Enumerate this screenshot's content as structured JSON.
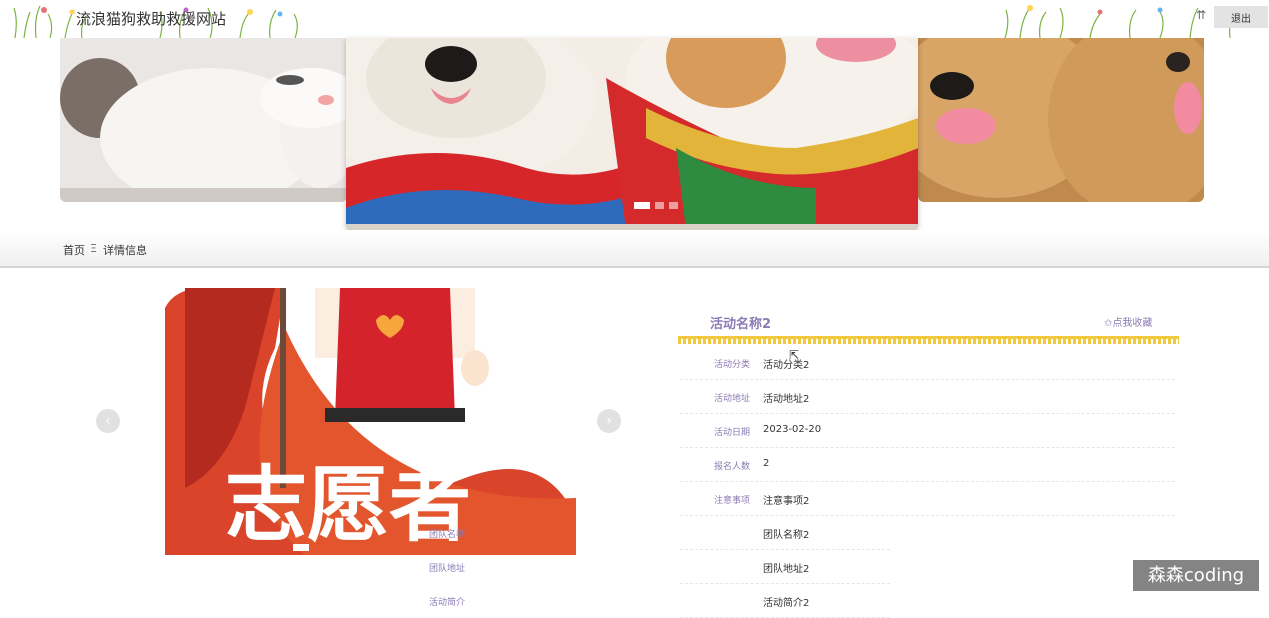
{
  "header": {
    "site_title": "流浪猫狗救助救援网站",
    "user_icon": "user-icon",
    "logout_label": "退出"
  },
  "breadcrumb": {
    "home": "首页",
    "separator": "Ξ",
    "current": "详情信息"
  },
  "banner": {
    "slides": [
      "kitten",
      "dogs-in-costume",
      "golden-retriever"
    ],
    "active_slide": 1,
    "dot_count": 3
  },
  "gallery": {
    "image_text": "志愿者",
    "prev_icon": "chevron-left-icon",
    "next_icon": "chevron-right-icon",
    "prev_glyph": "‹",
    "next_glyph": "›"
  },
  "detail": {
    "title": "活动名称2",
    "favorite": "✩点我收藏",
    "fields": [
      {
        "label": "活动分类",
        "value": "活动分类2"
      },
      {
        "label": "活动地址",
        "value": "活动地址2"
      },
      {
        "label": "活动日期",
        "value": "2023-02-20"
      },
      {
        "label": "报名人数",
        "value": "2"
      },
      {
        "label": "注意事项",
        "value": "注意事项2"
      },
      {
        "label": "团队名称",
        "value": "团队名称2"
      },
      {
        "label": "团队地址",
        "value": "团队地址2"
      },
      {
        "label": "活动简介",
        "value": "活动简介2"
      }
    ]
  },
  "watermark": "森森coding",
  "colors": {
    "label_purple": "#8b7bb5",
    "fringe_yellow": "#f0c93c"
  }
}
